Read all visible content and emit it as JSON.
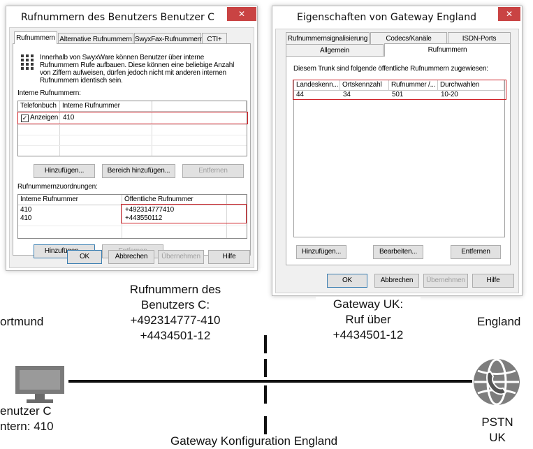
{
  "dialog_user": {
    "title": "Rufnummern des Benutzers Benutzer C",
    "close": "✕",
    "tabs": [
      "Rufnummern",
      "Alternative Rufnummern",
      "SwyxFax-Rufnummern",
      "CTI+"
    ],
    "info_text": [
      "Innerhalb von SwyxWare können Benutzer über interne",
      "Rufnummern Rufe aufbauen. Diese können eine beliebige Anzahl",
      "von Ziffern aufweisen, dürfen jedoch nicht mit anderen internen",
      "Rufnummern identisch sein."
    ],
    "internal_label": "Interne Rufnummern:",
    "internal_headers": [
      "Telefonbuch",
      "Interne Rufnummer"
    ],
    "internal_row": {
      "phonebook": "Anzeigen",
      "number": "410"
    },
    "buttons1": [
      "Hinzufügen...",
      "Bereich hinzufügen...",
      "Entfernen"
    ],
    "mapping_label": "Rufnummernzuordnungen:",
    "mapping_headers": [
      "Interne Rufnummer",
      "Öffentliche Rufnummer"
    ],
    "mapping_rows": [
      {
        "internal": "410",
        "public": "+492314777410"
      },
      {
        "internal": "410",
        "public": "+443550112"
      }
    ],
    "buttons2": [
      "Hinzufügen...",
      "Entfernen"
    ],
    "footer": [
      "OK",
      "Abbrechen",
      "Übernehmen",
      "Hilfe"
    ]
  },
  "dialog_gateway": {
    "title": "Eigenschaften von Gateway England",
    "close": "✕",
    "tabs_back": [
      "Rufnummernsignalisierung",
      "Codecs/Kanäle",
      "ISDN-Ports"
    ],
    "tabs_front": [
      "Allgemein",
      "Rufnummern"
    ],
    "desc": "Diesem Trunk sind folgende öffentliche Rufnummern zugewiesen:",
    "headers": [
      "Landeskenn...",
      "Ortskennzahl",
      "Rufnummer /...",
      "Durchwahlen"
    ],
    "row": [
      "44",
      "34",
      "501",
      "10-20"
    ],
    "buttons": [
      "Hinzufügen...",
      "Bearbeiten...",
      "Entfernen"
    ],
    "footer": [
      "OK",
      "Abbrechen",
      "Übernehmen",
      "Hilfe"
    ]
  },
  "diagram": {
    "user_caption": [
      "Rufnummern des",
      "Benutzers C:",
      "+492314777-410",
      "+4434501-12"
    ],
    "gateway_caption": [
      "Gateway UK:",
      "Ruf über",
      "+4434501-12"
    ],
    "left_location": "ortmund",
    "right_location": "England",
    "computer_label": [
      "enutzer C",
      "ntern: 410"
    ],
    "pstn_label": [
      "PSTN",
      "UK"
    ],
    "bottom_caption": "Gateway Konfiguration England"
  }
}
